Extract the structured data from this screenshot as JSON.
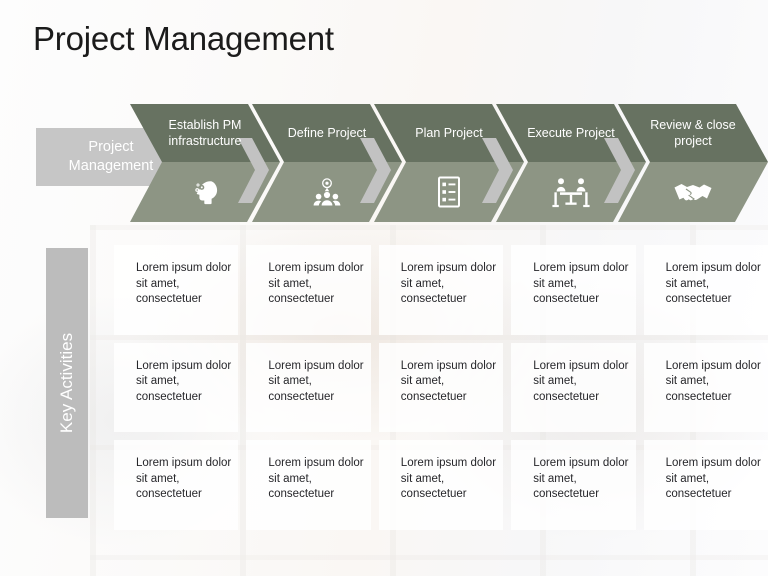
{
  "page_title": "Project Management",
  "colors": {
    "chevron_top": "#677261",
    "chevron_bottom": "#8d9584",
    "gray_plate": "#c6c6c6",
    "gray_bar": "#bcbcbc",
    "title_text": "#1b1b1b",
    "cell_text": "#26262a"
  },
  "stage_label": {
    "text": "Project Management"
  },
  "phases": [
    {
      "label": "Establish PM infrastructure",
      "icon": "head-gears-icon"
    },
    {
      "label": "Define Project",
      "icon": "people-target-icon"
    },
    {
      "label": "Plan Project",
      "icon": "checklist-icon"
    },
    {
      "label": "Execute Project",
      "icon": "meeting-table-icon"
    },
    {
      "label": "Review & close project",
      "icon": "handshake-icon"
    }
  ],
  "key_activities": {
    "label": "Key Activities",
    "rows": [
      [
        "Lorem ipsum dolor sit amet, consectetuer",
        "Lorem ipsum dolor sit amet, consectetuer",
        "Lorem ipsum dolor sit amet, consectetuer",
        "Lorem ipsum dolor sit amet, consectetuer",
        "Lorem ipsum dolor sit amet, consectetuer"
      ],
      [
        "Lorem ipsum dolor sit amet, consectetuer",
        "Lorem ipsum dolor sit amet, consectetuer",
        "Lorem ipsum dolor sit amet, consectetuer",
        "Lorem ipsum dolor sit amet, consectetuer",
        "Lorem ipsum dolor sit amet, consectetuer"
      ],
      [
        "Lorem ipsum dolor sit amet, consectetuer",
        "Lorem ipsum dolor sit amet, consectetuer",
        "Lorem ipsum dolor sit amet, consectetuer",
        "Lorem ipsum dolor sit amet, consectetuer",
        "Lorem ipsum dolor sit amet, consectetuer"
      ]
    ]
  }
}
